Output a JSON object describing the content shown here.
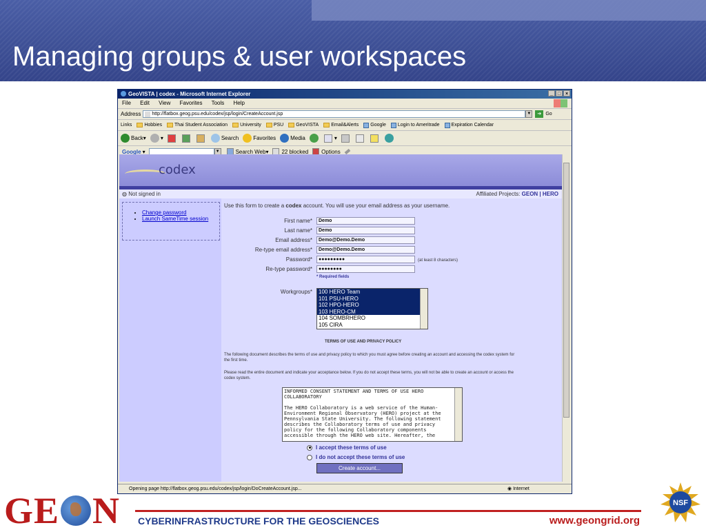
{
  "slide": {
    "title": "Managing groups & user workspaces",
    "footer_tagline": "CYBERINFRASTRUCTURE FOR THE GEOSCIENCES",
    "footer_url": "www.geongrid.org",
    "logo_text_left": "GE",
    "logo_text_right": "N",
    "nsf_text": "NSF",
    "colors": {
      "header": "#3d4f95",
      "accent_red": "#b91c1c",
      "tagline_blue": "#1f3a8a"
    }
  },
  "browser": {
    "window_title": "GeoVISTA | codex - Microsoft Internet Explorer",
    "menu": [
      "File",
      "Edit",
      "View",
      "Favorites",
      "Tools",
      "Help"
    ],
    "address_label": "Address",
    "address_url": "http://flatbox.geog.psu.edu/codex/jsp/login/CreateAccount.jsp",
    "go_label": "Go",
    "links_label": "Links",
    "links": [
      "Hobbies",
      "Thai Student Association",
      "University",
      "PSU",
      "GeoVISTA",
      "Email&Alerts",
      "Google",
      "Login to Ameritrade",
      "Expiration Calendar"
    ],
    "toolbar": {
      "back": "Back",
      "search": "Search",
      "favorites": "Favorites",
      "media": "Media"
    },
    "google_label": "Google",
    "google_search_web": "Search Web",
    "google_blocked": "22 blocked",
    "google_options": "Options",
    "status_text": "Opening page http://flatbox.geog.psu.edu/codex/jsp/login/DoCreateAccount.jsp...",
    "status_zone": "Internet"
  },
  "page": {
    "app_name": "codex",
    "signed_in_status": "Not signed in",
    "affiliated_label": "Affiliated Projects:",
    "affiliated_projects": "GEON | HERO",
    "side_links": [
      "Change password",
      "Launch SameTime session"
    ],
    "intro_pre": "Use this form to create a ",
    "intro_bold": "codex",
    "intro_post": " account. You will use your email address as your username.",
    "fields": {
      "first_name": {
        "label": "First name*",
        "value": "Demo"
      },
      "last_name": {
        "label": "Last name*",
        "value": "Demo"
      },
      "email": {
        "label": "Email address*",
        "value": "Demo@Demo.Demo"
      },
      "email_confirm": {
        "label": "Re-type email address*",
        "value": "Demo@Demo.Demo"
      },
      "password": {
        "label": "Password*",
        "value": "●●●●●●●●●"
      },
      "password_confirm": {
        "label": "Re-type password*",
        "value": "●●●●●●●●"
      }
    },
    "password_hint": "(at least 8 characters)",
    "required_note": "* Required fields",
    "workgroups_label": "Workgroups*",
    "workgroups": [
      "100 HERO Team",
      "101 PSU-HERO",
      "102 HPO-HERO",
      "103 HERO-CM",
      "104 SOMBRHERO",
      "105 CIRA"
    ],
    "terms_heading": "TERMS OF USE AND PRIVACY POLICY",
    "terms_para1": "The following document describes the terms of use and privacy policy to which you must agree before creating an account and accessing the codex system for the first time.",
    "terms_para2": "Please read the entire document and indicate your acceptance below. If you do not accept these terms, you will not be able to create an account or access the codex system.",
    "consent_heading": "INFORMED CONSENT STATEMENT AND TERMS OF USE HERO COLLABORATORY",
    "consent_body": "The HERO Collaboratory is a web service of the Human-Environment Regional Observatory (HERO) project at the Pennsylvania State University. The following statement describes the Collaboratory terms of use and privacy policy for the following Collaboratory components accessible through the HERO web site. Hereafter, the",
    "accept_label": "I accept these terms of use",
    "decline_label": "I do not accept these terms of use",
    "create_button": "Create account..."
  }
}
